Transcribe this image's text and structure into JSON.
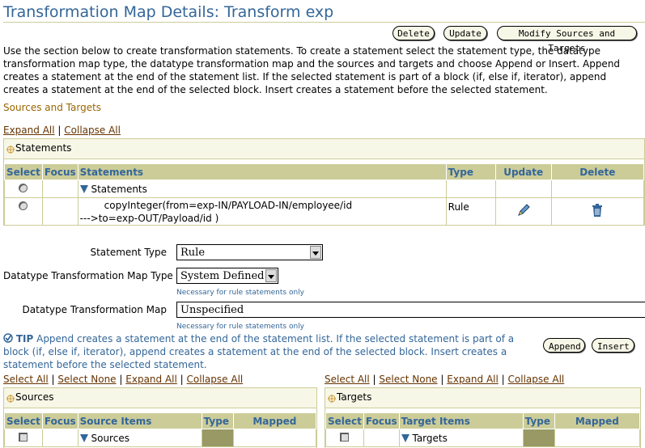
{
  "page": {
    "title": "Transformation Map Details: Transform exp",
    "buttons": {
      "delete": "Delete",
      "update": "Update",
      "modify": "Modify Sources and Targets"
    },
    "description": "Use the section below to create transformation statements. To create a statement select the statement type, the datatype transformation map type, the datatype transformation map and the sources and targets and choose Append or Insert. Append creates a statement at the end of the statement list. If the selected statement is part of a block (if, else if, iterator), append creates a statement at the end of the selected block. Insert creates a statement before the selected statement."
  },
  "sources_targets": {
    "heading": "Sources and Targets",
    "expand_all": "Expand All",
    "collapse_all": "Collapse All"
  },
  "statements_table": {
    "box_title": "Statements",
    "columns": [
      "Select",
      "Focus",
      "Statements",
      "Type",
      "Update",
      "Delete"
    ],
    "rows": [
      {
        "statement": "Statements",
        "type": ""
      },
      {
        "statement": "copyInteger(from=exp-IN/PAYLOAD-IN/employee/id --->to=exp-OUT/Payload/id )",
        "line1": "copyInteger(from=exp-IN/PAYLOAD-IN/employee/id",
        "line2": "--->to=exp-OUT/Payload/id )",
        "type": "Rule"
      }
    ]
  },
  "form": {
    "statement_type_label": "Statement Type",
    "statement_type_value": "Rule",
    "dtm_type_label": "Datatype Transformation Map Type",
    "dtm_type_value": "System Defined",
    "dtm_type_hint": "Necessary for rule statements only",
    "dtm_label": "Datatype Transformation Map",
    "dtm_value": "Unspecified",
    "dtm_hint": "Necessary for rule statements only"
  },
  "tip": {
    "label": "TIP",
    "text": "Append creates a statement at the end of the statement list. If the selected statement is part of a block (if, else if, iterator), append creates a statement at the end of the selected block. Insert creates a statement before the selected statement.",
    "append": "Append",
    "insert": "Insert"
  },
  "sources": {
    "select_all": "Select All",
    "select_none": "Select None",
    "expand_all": "Expand All",
    "collapse_all": "Collapse All",
    "box_title": "Sources",
    "columns": [
      "Select",
      "Focus",
      "Source Items",
      "Type",
      "Mapped"
    ],
    "root": "Sources"
  },
  "targets": {
    "select_all": "Select All",
    "select_none": "Select None",
    "expand_all": "Expand All",
    "collapse_all": "Collapse All",
    "box_title": "Targets",
    "columns": [
      "Select",
      "Focus",
      "Target Items",
      "Type",
      "Mapped"
    ],
    "root": "Targets"
  },
  "colors": {
    "title": "#336699",
    "header_bg": "#CCCC99",
    "box_bg": "#F7F7E7",
    "link": "#663300"
  }
}
